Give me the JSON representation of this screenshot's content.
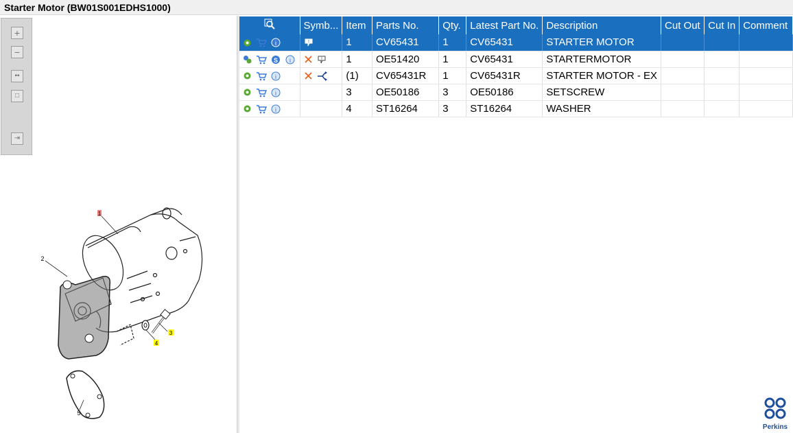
{
  "title": "Starter Motor (BW01S001EDHS1000)",
  "toolbar": {
    "buttons": [
      {
        "name": "zoom-in-icon"
      },
      {
        "name": "zoom-out-icon"
      },
      {
        "name": "fit-all-icon"
      },
      {
        "name": "fit-page-icon"
      },
      {
        "name": "export-icon"
      }
    ]
  },
  "drawing": {
    "callouts": [
      "1",
      "2",
      "3",
      "4",
      "5"
    ],
    "highlight_colors": {
      "selected": "#f08080",
      "marked": "#ffff00"
    }
  },
  "table": {
    "columns": [
      "",
      "Symb...",
      "Item",
      "Parts No.",
      "Qty.",
      "Latest Part No.",
      "Description",
      "Cut Out",
      "Cut In",
      "Comment"
    ],
    "rows": [
      {
        "actions": [
          "gear-icon",
          "cart-icon",
          "info-icon"
        ],
        "symbols": [
          "balloon-icon"
        ],
        "item": "1",
        "part_no": "CV65431",
        "qty": "1",
        "latest": "CV65431",
        "description": "STARTER MOTOR",
        "cut_out": "",
        "cut_in": "",
        "comment": "",
        "selected": true
      },
      {
        "actions": [
          "gears-icon",
          "cart-icon",
          "s-icon",
          "info-icon"
        ],
        "symbols": [
          "cross-icon",
          "balloon-icon"
        ],
        "item": "1",
        "part_no": "OE51420",
        "qty": "1",
        "latest": "CV65431",
        "description": "STARTERMOTOR",
        "cut_out": "",
        "cut_in": "",
        "comment": "",
        "selected": false
      },
      {
        "actions": [
          "gear-icon",
          "cart-icon",
          "info-icon"
        ],
        "symbols": [
          "cross-icon",
          "replace-icon"
        ],
        "item": "(1)",
        "part_no": "CV65431R",
        "qty": "1",
        "latest": "CV65431R",
        "description": "STARTER MOTOR - EX",
        "cut_out": "",
        "cut_in": "",
        "comment": "",
        "selected": false
      },
      {
        "actions": [
          "gear-icon",
          "cart-icon",
          "info-icon"
        ],
        "symbols": [],
        "item": "3",
        "part_no": "OE50186",
        "qty": "3",
        "latest": "OE50186",
        "description": "SETSCREW",
        "cut_out": "",
        "cut_in": "",
        "comment": "",
        "selected": false
      },
      {
        "actions": [
          "gear-icon",
          "cart-icon",
          "info-icon"
        ],
        "symbols": [],
        "item": "4",
        "part_no": "ST16264",
        "qty": "3",
        "latest": "ST16264",
        "description": "WASHER",
        "cut_out": "",
        "cut_in": "",
        "comment": "",
        "selected": false
      }
    ]
  },
  "brand": {
    "name": "Perkins",
    "color": "#1d4e9e"
  },
  "colors": {
    "accent": "#1a6fbf"
  }
}
